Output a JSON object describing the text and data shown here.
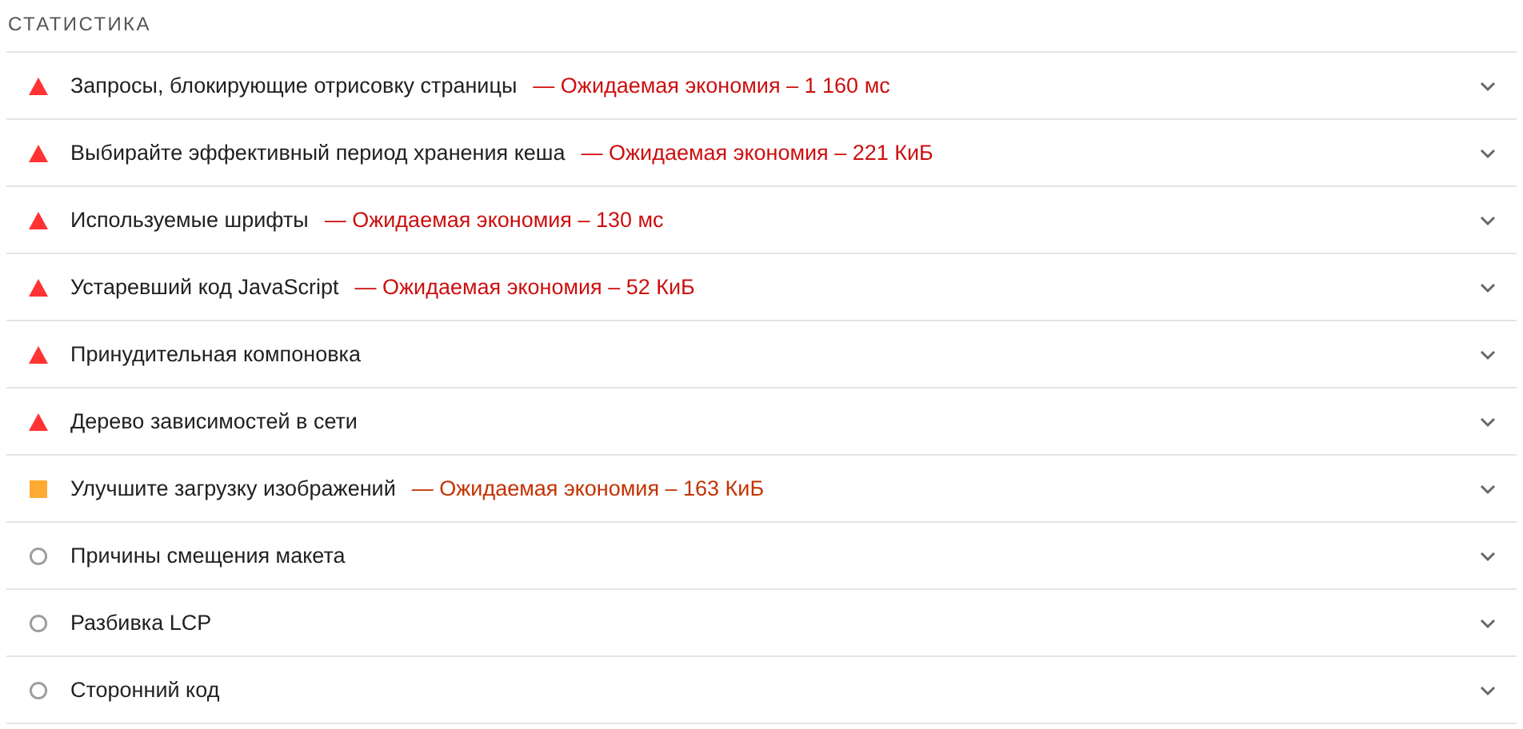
{
  "section_title": "СТАТИСТИКА",
  "audits": [
    {
      "kind": "fail",
      "title": "Запросы, блокирующие отрисовку страницы",
      "savings": "— Ожидаемая экономия – 1 160 мс",
      "expanded": false
    },
    {
      "kind": "fail",
      "title": "Выбирайте эффективный период хранения кеша",
      "savings": "— Ожидаемая экономия – 221 КиБ",
      "expanded": false
    },
    {
      "kind": "fail",
      "title": "Используемые шрифты",
      "savings": "— Ожидаемая экономия – 130 мс",
      "expanded": false
    },
    {
      "kind": "fail",
      "title": "Устаревший код JavaScript",
      "savings": "— Ожидаемая экономия – 52 КиБ",
      "expanded": false
    },
    {
      "kind": "fail",
      "title": "Принудительная компоновка",
      "expanded": false
    },
    {
      "kind": "fail",
      "title": "Дерево зависимостей в сети",
      "expanded": false
    },
    {
      "kind": "average",
      "title": "Улучшите загрузку изображений",
      "savings": "— Ожидаемая экономия – 163 КиБ",
      "expanded": false
    },
    {
      "kind": "info",
      "title": "Причины смещения макета",
      "expanded": false
    },
    {
      "kind": "info",
      "title": "Разбивка LCP",
      "expanded": false
    },
    {
      "kind": "info",
      "title": "Сторонний код",
      "expanded": false
    }
  ]
}
